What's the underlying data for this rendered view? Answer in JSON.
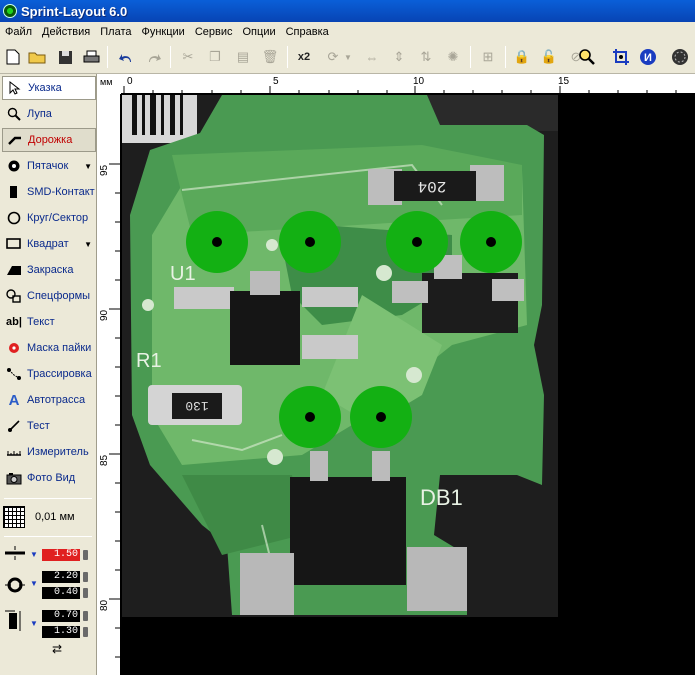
{
  "window": {
    "title": "Sprint-Layout 6.0"
  },
  "menu": [
    "Файл",
    "Действия",
    "Плата",
    "Функции",
    "Сервис",
    "Опции",
    "Справка"
  ],
  "toolbar": {
    "multiply_label": "x2"
  },
  "tools": [
    {
      "label": "Указка",
      "icon": "pointer-icon",
      "state": "active"
    },
    {
      "label": "Лупа",
      "icon": "magnifier-icon"
    },
    {
      "label": "Дорожка",
      "icon": "track-icon",
      "state": "pressed",
      "color": "#c00000"
    },
    {
      "label": "Пятачок",
      "icon": "pad-icon",
      "dropdown": true
    },
    {
      "label": "SMD-Контакт",
      "icon": "smd-pad-icon"
    },
    {
      "label": "Круг/Сектор",
      "icon": "circle-icon"
    },
    {
      "label": "Квадрат",
      "icon": "rectangle-icon",
      "dropdown": true
    },
    {
      "label": "Закраска",
      "icon": "fill-icon"
    },
    {
      "label": "Спецформы",
      "icon": "special-shapes-icon"
    },
    {
      "label": "Текст",
      "icon": "text-icon"
    },
    {
      "label": "Маска пайки",
      "icon": "solder-mask-icon"
    },
    {
      "label": "Трассировка",
      "icon": "routing-icon"
    },
    {
      "label": "Автотрасса",
      "icon": "autoroute-icon"
    },
    {
      "label": "Тест",
      "icon": "test-icon"
    },
    {
      "label": "Измеритель",
      "icon": "measure-icon"
    },
    {
      "label": "Фото Вид",
      "icon": "photo-view-icon"
    }
  ],
  "grid": {
    "value": "0,01 мм"
  },
  "params": {
    "track_width": "1.50",
    "pad_outer": "2.20",
    "pad_inner": "0.40",
    "smd_width": "0.70",
    "smd_height": "1.30"
  },
  "ruler": {
    "unit": "мм",
    "top_labels": [
      "0",
      "5",
      "10",
      "15"
    ],
    "left_labels": [
      "95",
      "90",
      "85",
      "80"
    ]
  },
  "pcb_photo": {
    "silkscreen": [
      "U1",
      "R1",
      "DB1",
      "204",
      "130"
    ],
    "pad_color": "#13b013",
    "board_color": "#4a9a52"
  }
}
